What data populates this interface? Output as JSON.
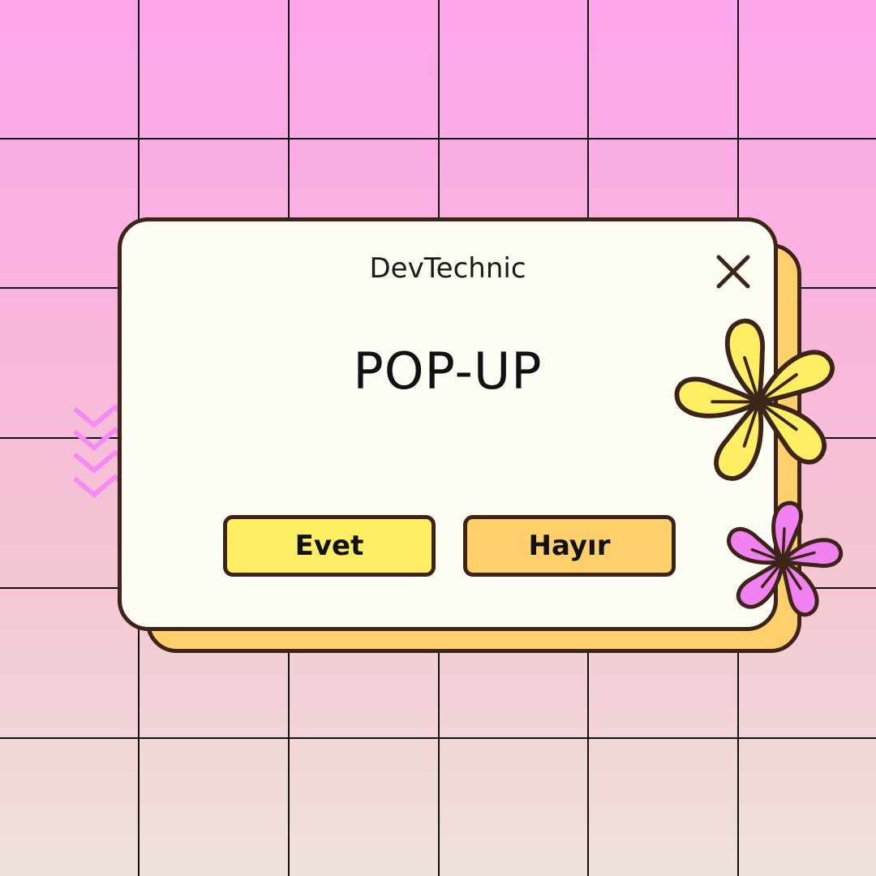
{
  "popup": {
    "title": "DevTechnic",
    "heading": "POP-UP",
    "yes_label": "Evet",
    "no_label": "Hayır"
  },
  "colors": {
    "background_top": "#FCA6EC",
    "background_bottom": "#EFE2DC",
    "grid_line": "#111111",
    "popup_bg": "#FDFDF3",
    "popup_shadow": "#FDD06C",
    "outline": "#3D2418",
    "yes_button": "#FDEE63",
    "no_button": "#FDD06C",
    "yellow_flower": "#FDEE63",
    "pink_flower": "#F181F0",
    "zigzag": "#F58AF5"
  },
  "icons": {
    "close": "close-icon",
    "zigzag": "zigzag-decoration",
    "flower_large": "yellow-flower",
    "flower_small": "pink-flower"
  }
}
